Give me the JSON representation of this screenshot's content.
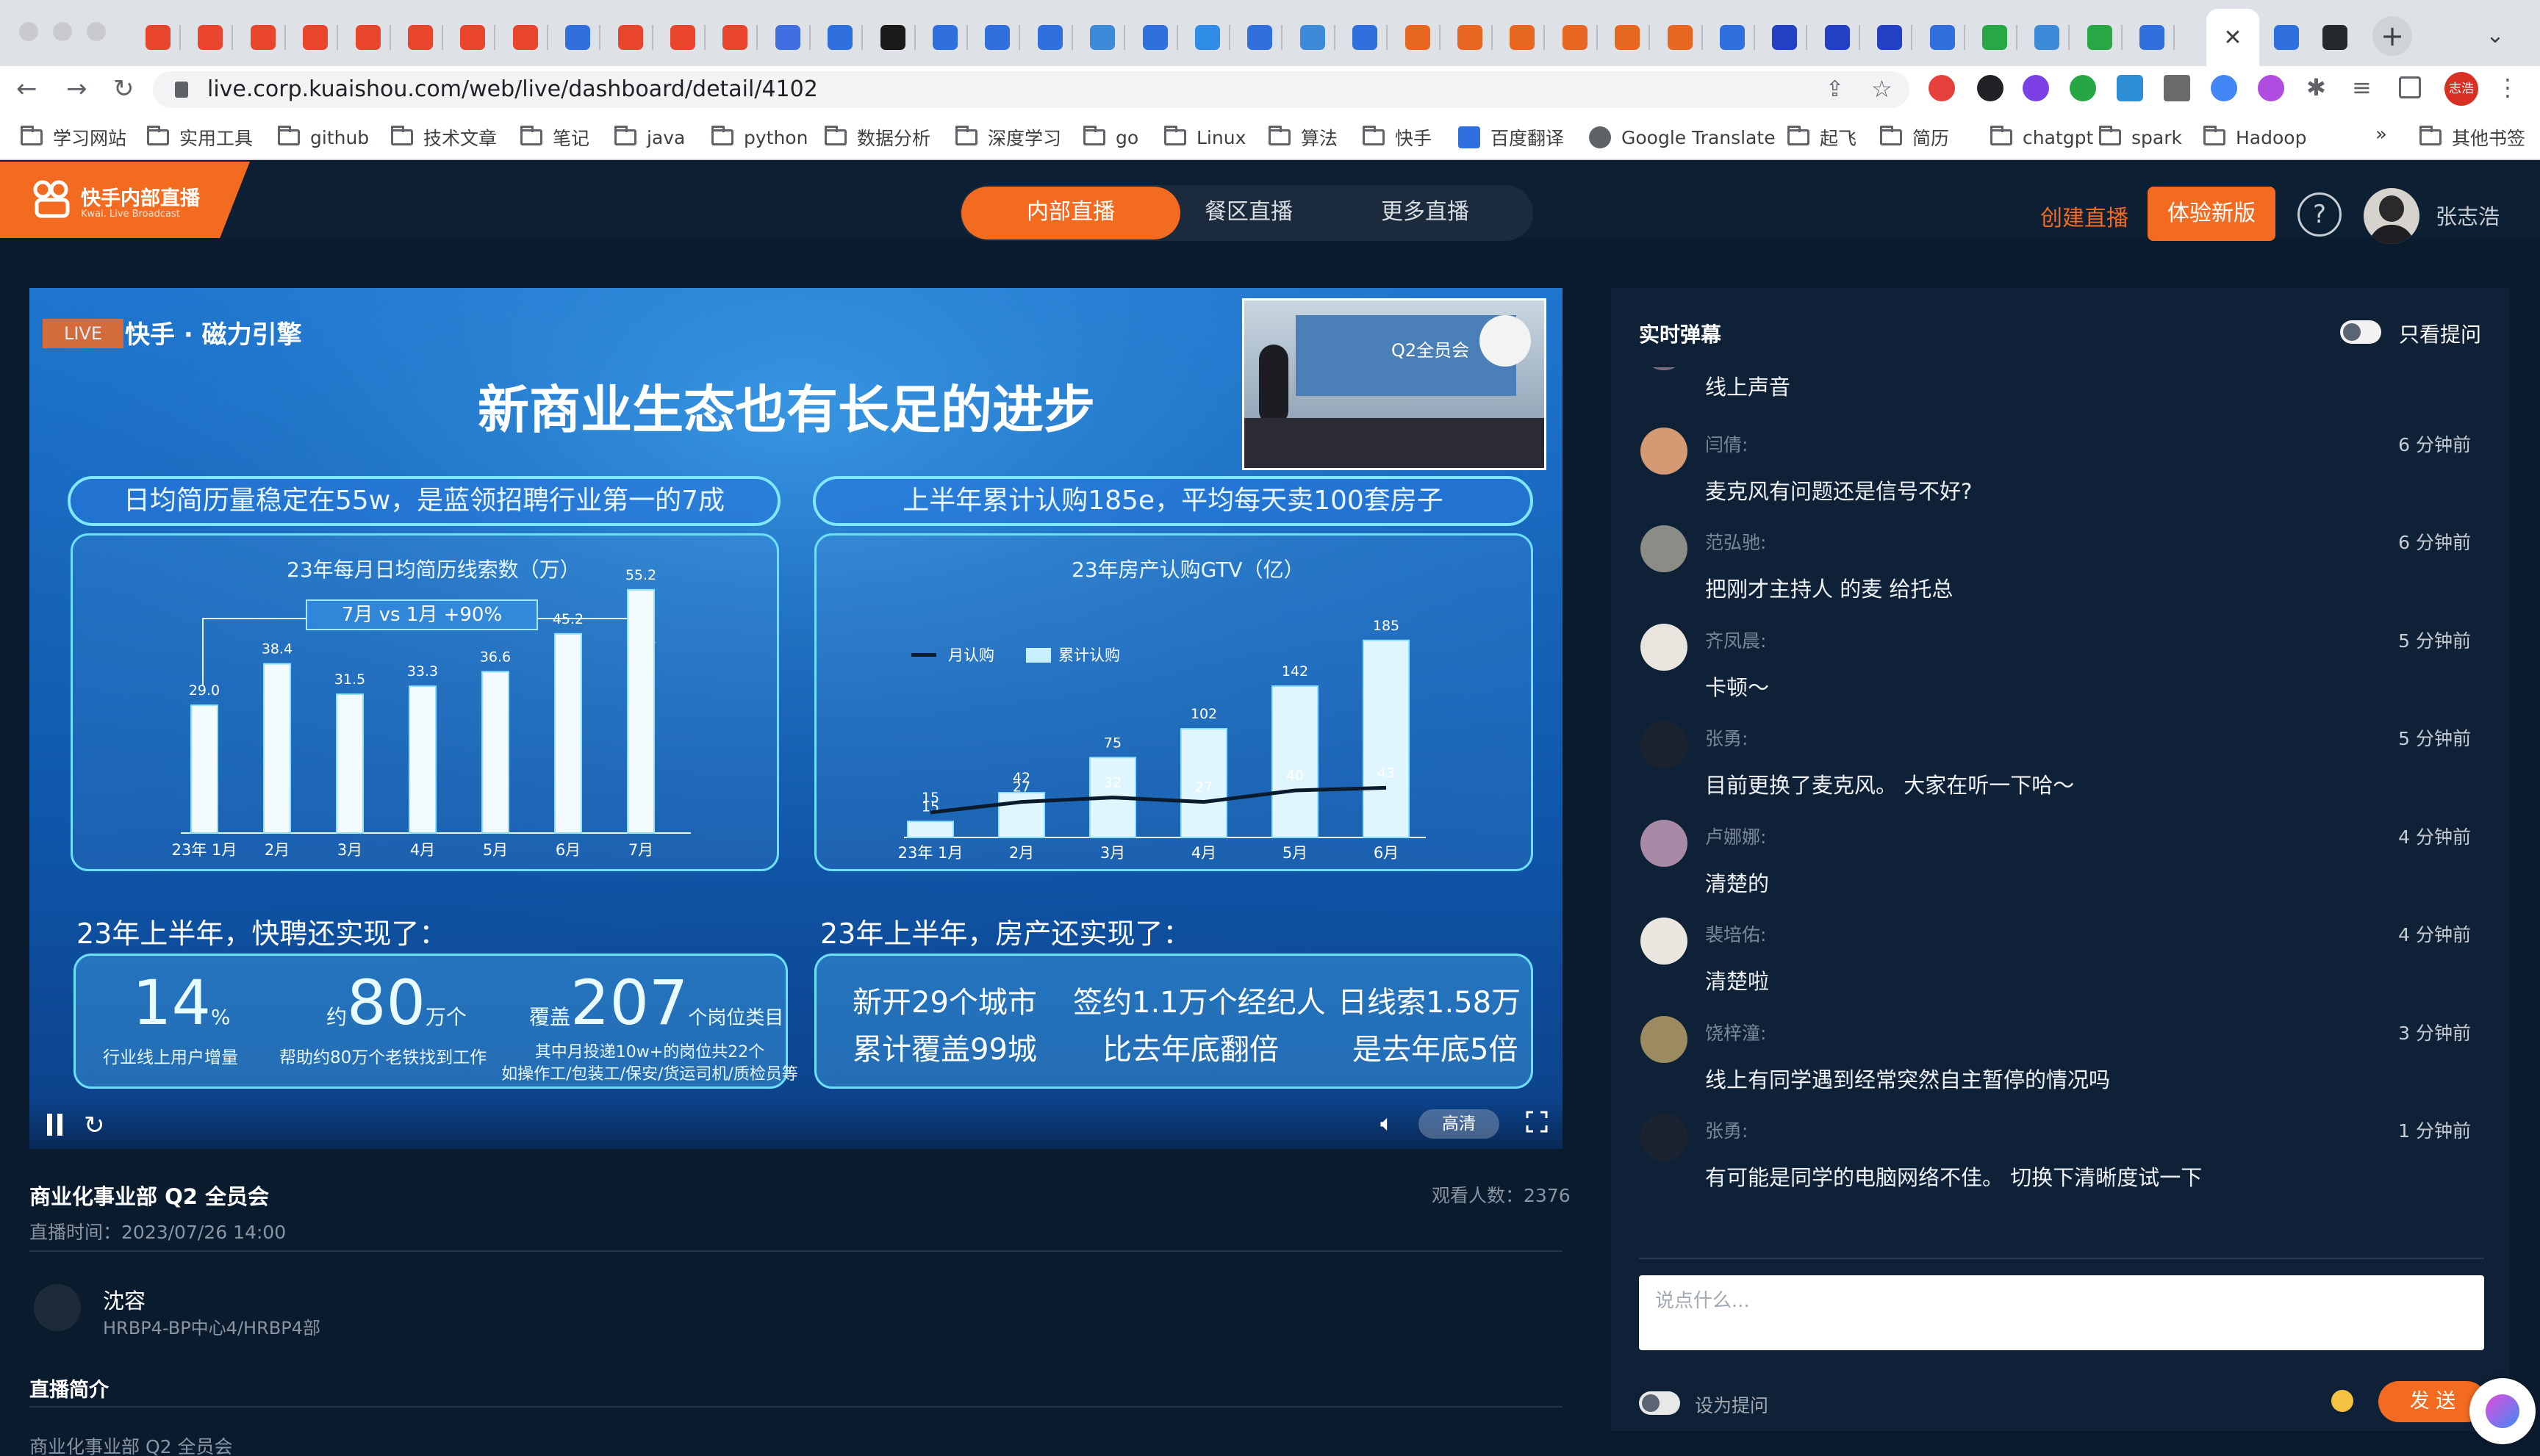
{
  "browser": {
    "url": "live.corp.kuaishou.com/web/live/dashboard/detail/4102",
    "active_tab_close": "✕",
    "new_tab": "+",
    "bookmarks": [
      {
        "label": "学习网站"
      },
      {
        "label": "实用工具"
      },
      {
        "label": "github"
      },
      {
        "label": "技术文章"
      },
      {
        "label": "笔记"
      },
      {
        "label": "java"
      },
      {
        "label": "python"
      },
      {
        "label": "数据分析"
      },
      {
        "label": "深度学习"
      },
      {
        "label": "go"
      },
      {
        "label": "Linux"
      },
      {
        "label": "算法"
      },
      {
        "label": "快手"
      },
      {
        "label": "百度翻译"
      },
      {
        "label": "Google Translate"
      },
      {
        "label": "起飞"
      },
      {
        "label": "简历"
      },
      {
        "label": "chatgpt"
      },
      {
        "label": "spark"
      },
      {
        "label": "Hadoop"
      }
    ],
    "bookmarks_more": "»",
    "other_bookmarks": "其他书签",
    "profile_label": "志浩"
  },
  "header": {
    "logo_title": "快手内部直播",
    "logo_subtitle": "Kwai. Live Broadcast",
    "nav": [
      {
        "label": "内部直播"
      },
      {
        "label": "餐区直播"
      },
      {
        "label": "更多直播"
      }
    ],
    "create_live": "创建直播",
    "try_new": "体验新版",
    "help": "?",
    "user_name": "张志浩"
  },
  "video": {
    "live_badge": "LIVE",
    "brand": "快手 · 磁力引擎",
    "slide_title": "新商业生态也有长足的进步",
    "left_banner": "日均简历量稳定在55w，是蓝领招聘行业第一的7成",
    "right_banner": "上半年累计认购185e，平均每天卖100套房子",
    "left_section": "23年上半年，快聘还实现了：",
    "right_section": "23年上半年，房产还实现了：",
    "stats_left": [
      {
        "num": "14",
        "unit": "%",
        "desc": "行业线上用户增量"
      },
      {
        "num": "80",
        "unit": "万个",
        "pre": "约",
        "desc": "帮助约80万个老铁找到工作"
      },
      {
        "num": "207",
        "unit": "个岗位类目",
        "pre": "覆盖",
        "desc": "其中月投递10w+的岗位共22个",
        "desc2": "如操作工/包装工/保安/货运司机/质检员等"
      }
    ],
    "stats_right": [
      {
        "l1": "新开29个城市",
        "l2": "累计覆盖99城"
      },
      {
        "l1": "签约1.1万个经纪人",
        "l2": "比去年底翻倍"
      },
      {
        "l1": "日线索1.58万",
        "l2": "是去年底5倍"
      }
    ],
    "quality": "高清",
    "inset_text": "Q2全员会"
  },
  "chart_data": [
    {
      "type": "bar",
      "title": "23年每月日均简历线索数（万）",
      "annotation": "7月 vs 1月 +90%",
      "categories": [
        "23年 1月",
        "2月",
        "3月",
        "4月",
        "5月",
        "6月",
        "7月"
      ],
      "values": [
        29.0,
        38.4,
        31.5,
        33.3,
        36.6,
        45.2,
        55.2
      ],
      "value_labels": [
        "29.0",
        "38.4",
        "31.5",
        "33.3",
        "36.6",
        "45.2",
        "55.2"
      ],
      "ylim": [
        0,
        60
      ]
    },
    {
      "type": "bar",
      "title": "23年房产认购GTV（亿）",
      "categories": [
        "23年 1月",
        "2月",
        "3月",
        "4月",
        "5月",
        "6月"
      ],
      "series": [
        {
          "name": "累计认购",
          "type": "bar",
          "values": [
            15,
            42,
            75,
            102,
            142,
            185
          ]
        },
        {
          "name": "月认购",
          "type": "line",
          "values": [
            15,
            27,
            32,
            27,
            40,
            43
          ]
        }
      ],
      "ylim": [
        0,
        200
      ]
    }
  ],
  "info": {
    "title": "商业化事业部 Q2 全员会",
    "viewers_label": "观看人数：",
    "viewers": "2376",
    "time_label": "直播时间：",
    "time": "2023/07/26 14:00",
    "host_name": "沈容",
    "host_dept": "HRBP4-BP中心4/HRBP4部",
    "intro_heading": "直播简介",
    "intro_text": "商业化事业部 Q2 全员会"
  },
  "chat": {
    "title": "实时弹幕",
    "only_questions": "只看提问",
    "messages": [
      {
        "user": "",
        "time": "",
        "text": "线上声音",
        "avatar": "#7a6e80"
      },
      {
        "user": "闫倩:",
        "time": "6 分钟前",
        "text": "麦克风有问题还是信号不好?",
        "avatar": "#d49a74"
      },
      {
        "user": "范弘驰:",
        "time": "6 分钟前",
        "text": "把刚才主持人 的麦 给托总",
        "avatar": "#8c8c86"
      },
      {
        "user": "齐凤晨:",
        "time": "5 分钟前",
        "text": "卡顿～",
        "avatar": "#e9e4dd"
      },
      {
        "user": "张勇:",
        "time": "5 分钟前",
        "text": "目前更换了麦克风。 大家在听一下哈～",
        "avatar": "#1c2330"
      },
      {
        "user": "卢娜娜:",
        "time": "4 分钟前",
        "text": "清楚的",
        "avatar": "#a98aa6"
      },
      {
        "user": "裴培佑:",
        "time": "4 分钟前",
        "text": "清楚啦",
        "avatar": "#ece6e0"
      },
      {
        "user": "饶梓潼:",
        "time": "3 分钟前",
        "text": "线上有同学遇到经常突然自主暂停的情况吗",
        "avatar": "#9c8a60"
      },
      {
        "user": "张勇:",
        "time": "1 分钟前",
        "text": "有可能是同学的电脑网络不佳。 切换下清晰度试一下",
        "avatar": "#1c2330"
      }
    ],
    "input_placeholder": "说点什么...",
    "set_question": "设为提问",
    "send": "发 送"
  },
  "colors": {
    "accent": "#f36b21",
    "page_bg": "#0b1b2e",
    "panel_bg": "#0f2137",
    "slide_bg": "#1560b6"
  }
}
